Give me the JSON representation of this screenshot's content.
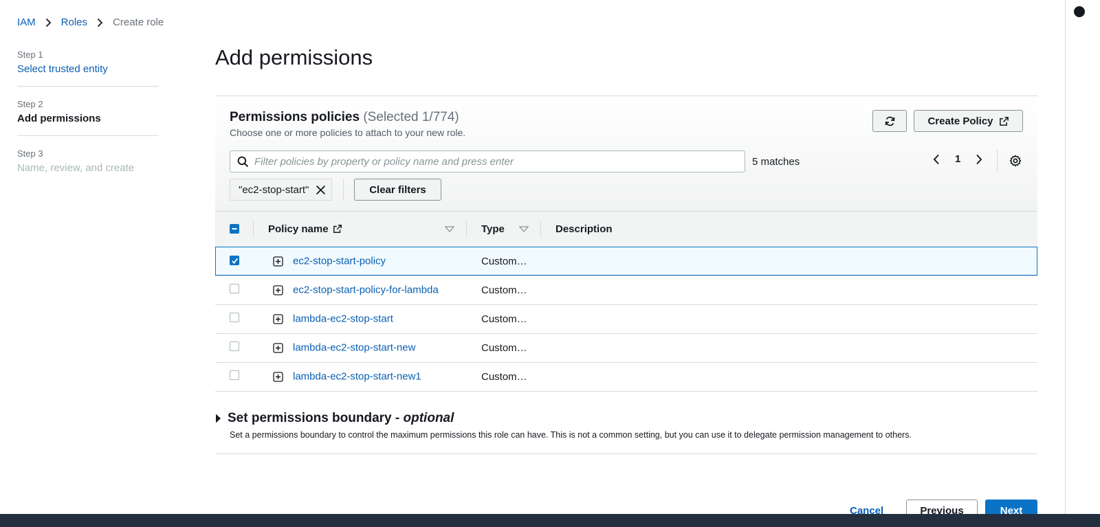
{
  "breadcrumb": [
    {
      "label": "IAM"
    },
    {
      "label": "Roles"
    },
    {
      "label": "Create role"
    }
  ],
  "steps": [
    {
      "num": "Step 1",
      "title": "Select trusted entity",
      "state": "link"
    },
    {
      "num": "Step 2",
      "title": "Add permissions",
      "state": "active"
    },
    {
      "num": "Step 3",
      "title": "Name, review, and create",
      "state": "disabled"
    }
  ],
  "page_title": "Add permissions",
  "policies": {
    "title": "Permissions policies",
    "selected_count": "(Selected 1/774)",
    "description": "Choose one or more policies to attach to your new role.",
    "create_policy_label": "Create Policy",
    "search_placeholder": "Filter policies by property or policy name and press enter",
    "matches": "5 matches",
    "page": "1",
    "filter_token": "\"ec2-stop-start\"",
    "clear_filters_label": "Clear filters",
    "columns": {
      "name": "Policy name",
      "type": "Type",
      "description": "Description"
    },
    "rows": [
      {
        "name": "ec2-stop-start-policy",
        "type": "Custom…",
        "selected": true
      },
      {
        "name": "ec2-stop-start-policy-for-lambda",
        "type": "Custom…",
        "selected": false
      },
      {
        "name": "lambda-ec2-stop-start",
        "type": "Custom…",
        "selected": false
      },
      {
        "name": "lambda-ec2-stop-start-new",
        "type": "Custom…",
        "selected": false
      },
      {
        "name": "lambda-ec2-stop-start-new1",
        "type": "Custom…",
        "selected": false
      }
    ]
  },
  "boundary": {
    "title": "Set permissions boundary -",
    "optional": "optional",
    "description": "Set a permissions boundary to control the maximum permissions this role can have. This is not a common setting, but you can use it to delegate permission management to others."
  },
  "footer": {
    "cancel_label": "Cancel",
    "previous_label": "Previous",
    "next_label": "Next"
  },
  "colors": {
    "link": "#0a5fb3",
    "primary": "#0a73c6",
    "header_bg": "#f2f3f3",
    "border": "#d5dbdb",
    "bottom_bar": "#232f3e"
  },
  "icons": [
    "chevron-right-icon",
    "refresh-icon",
    "external-link-icon",
    "search-icon",
    "chevron-left-icon",
    "gear-icon",
    "close-icon",
    "sort-down-icon",
    "expand-plus-icon",
    "caret-right-icon",
    "checkmark-icon",
    "minus-icon"
  ]
}
